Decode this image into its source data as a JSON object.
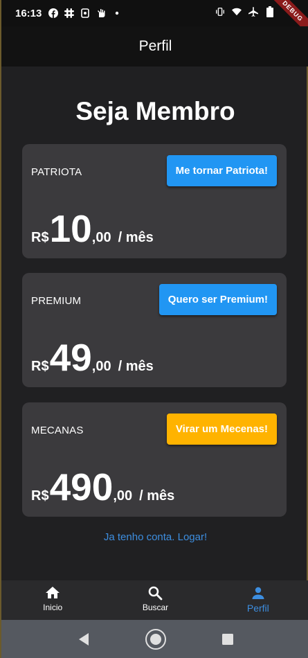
{
  "status_bar": {
    "time": "16:13",
    "debug_label": "DEBUG"
  },
  "app_bar": {
    "title": "Perfil"
  },
  "page": {
    "title": "Seja Membro"
  },
  "plans": [
    {
      "name": "PATRIOTA",
      "button_label": "Me tornar Patriota!",
      "button_color": "#2196f3",
      "currency": "R$",
      "price_int": "10",
      "price_dec": ",00",
      "period": "/ mês"
    },
    {
      "name": "PREMIUM",
      "button_label": "Quero ser Premium!",
      "button_color": "#2196f3",
      "currency": "R$",
      "price_int": "49",
      "price_dec": ",00",
      "period": "/ mês"
    },
    {
      "name": "MECANAS",
      "button_label": "Virar um Mecenas!",
      "button_color": "#ffb300",
      "currency": "R$",
      "price_int": "490",
      "price_dec": ",00",
      "period": "/ mês"
    }
  ],
  "login_link": "Ja tenho conta. Logar!",
  "bottom_nav": {
    "items": [
      {
        "label": "Inicio",
        "icon": "home-icon"
      },
      {
        "label": "Buscar",
        "icon": "search-icon"
      },
      {
        "label": "Perfil",
        "icon": "person-icon"
      }
    ],
    "active_color": "#3d8ee0"
  },
  "colors": {
    "background": "#202022",
    "card": "#3b3a3d",
    "accent_blue": "#2196f3",
    "accent_amber": "#ffb300"
  }
}
